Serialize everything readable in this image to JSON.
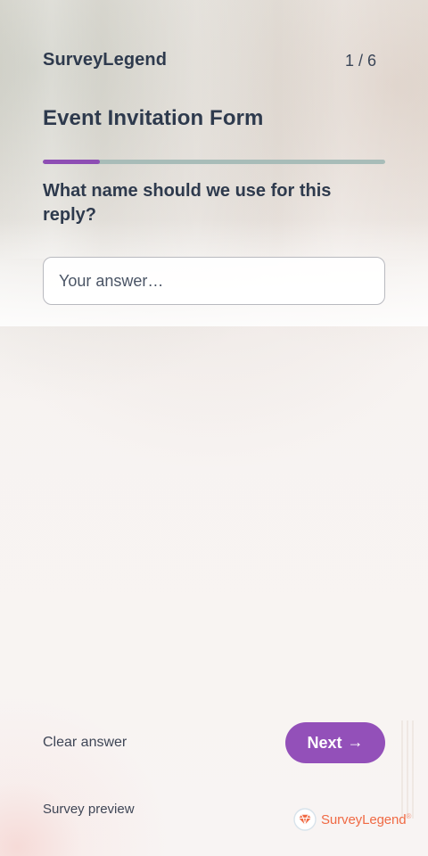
{
  "header": {
    "brand": "SurveyLegend",
    "step": "1 / 6",
    "title": "Event Invitation Form"
  },
  "progress": {
    "fraction": 0.1667,
    "fill_color": "#8e4eb4",
    "track_color": "#a8bcb8"
  },
  "question": {
    "text": "What name should we use for this reply?",
    "answer_placeholder": "Your answer…",
    "answer_value": ""
  },
  "actions": {
    "clear_label": "Clear answer",
    "next_label": "Next",
    "next_arrow": "→",
    "button_color": "#9350b9"
  },
  "footer": {
    "preview_label": "Survey preview",
    "logo_text": "SurveyLegend",
    "logo_trademark": "®",
    "logo_icon": "surveylegend-logo-icon",
    "logo_color": "#f06a44"
  }
}
